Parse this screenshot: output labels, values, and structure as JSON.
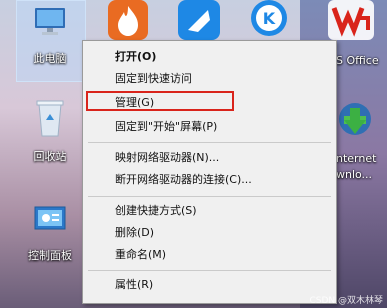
{
  "desktop": {
    "icons": [
      {
        "label": "此电脑"
      },
      {
        "label": "回收站"
      },
      {
        "label": "控制面板"
      },
      {
        "label": "S Office"
      },
      {
        "label": "nternet"
      },
      {
        "label": "wnlo..."
      }
    ]
  },
  "context_menu": {
    "items": [
      {
        "label": "打开(O)",
        "bold": true
      },
      {
        "label": "固定到快速访问"
      },
      {
        "label": "管理(G)"
      },
      {
        "label": "固定到\"开始\"屏幕(P)"
      },
      {
        "label": "映射网络驱动器(N)..."
      },
      {
        "label": "断开网络驱动器的连接(C)..."
      },
      {
        "label": "创建快捷方式(S)"
      },
      {
        "label": "删除(D)"
      },
      {
        "label": "重命名(M)"
      },
      {
        "label": "属性(R)"
      }
    ]
  },
  "watermark": "CSDN @双木林琴",
  "colors": {
    "highlight": "#d9241b",
    "menu_bg": "#f0f0f0"
  }
}
